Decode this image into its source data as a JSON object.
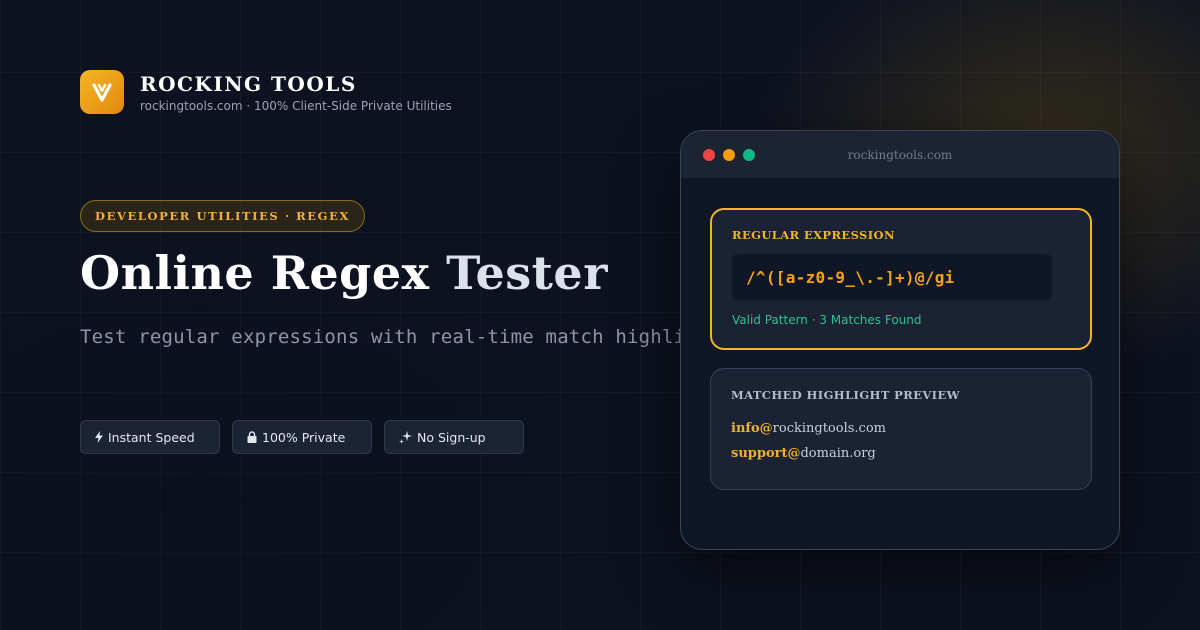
{
  "brand": {
    "name": "ROCKING TOOLS",
    "subtitle": "rockingtools.com · 100% Client-Side Private Utilities"
  },
  "category": "DEVELOPER UTILITIES · REGEX",
  "hero": {
    "title_a": "Online Regex",
    "title_b": "Tester",
    "subtitle": "Test regular expressions with real-time match highlights"
  },
  "chips": [
    {
      "icon": "lightning-icon",
      "label": "Instant Speed"
    },
    {
      "icon": "lock-icon",
      "label": "100% Private"
    },
    {
      "icon": "sparkles-icon",
      "label": "No Sign-up"
    }
  ],
  "window": {
    "url": "rockingtools.com",
    "dot_colors": [
      "#ef4444",
      "#f59e0b",
      "#10b981"
    ],
    "regex_card": {
      "label": "REGULAR EXPRESSION",
      "pattern": "/^([a-z0-9_\\.-]+)@/gi",
      "status": "Valid Pattern · 3 Matches Found"
    },
    "preview_card": {
      "label": "MATCHED HIGHLIGHT PREVIEW",
      "matches": [
        {
          "highlight": "info@",
          "rest": "rockingtools.com"
        },
        {
          "highlight": "support@",
          "rest": "domain.org"
        }
      ]
    }
  },
  "colors": {
    "accent": "#f1b622",
    "success": "#29c48a",
    "background": "#0d1220"
  }
}
